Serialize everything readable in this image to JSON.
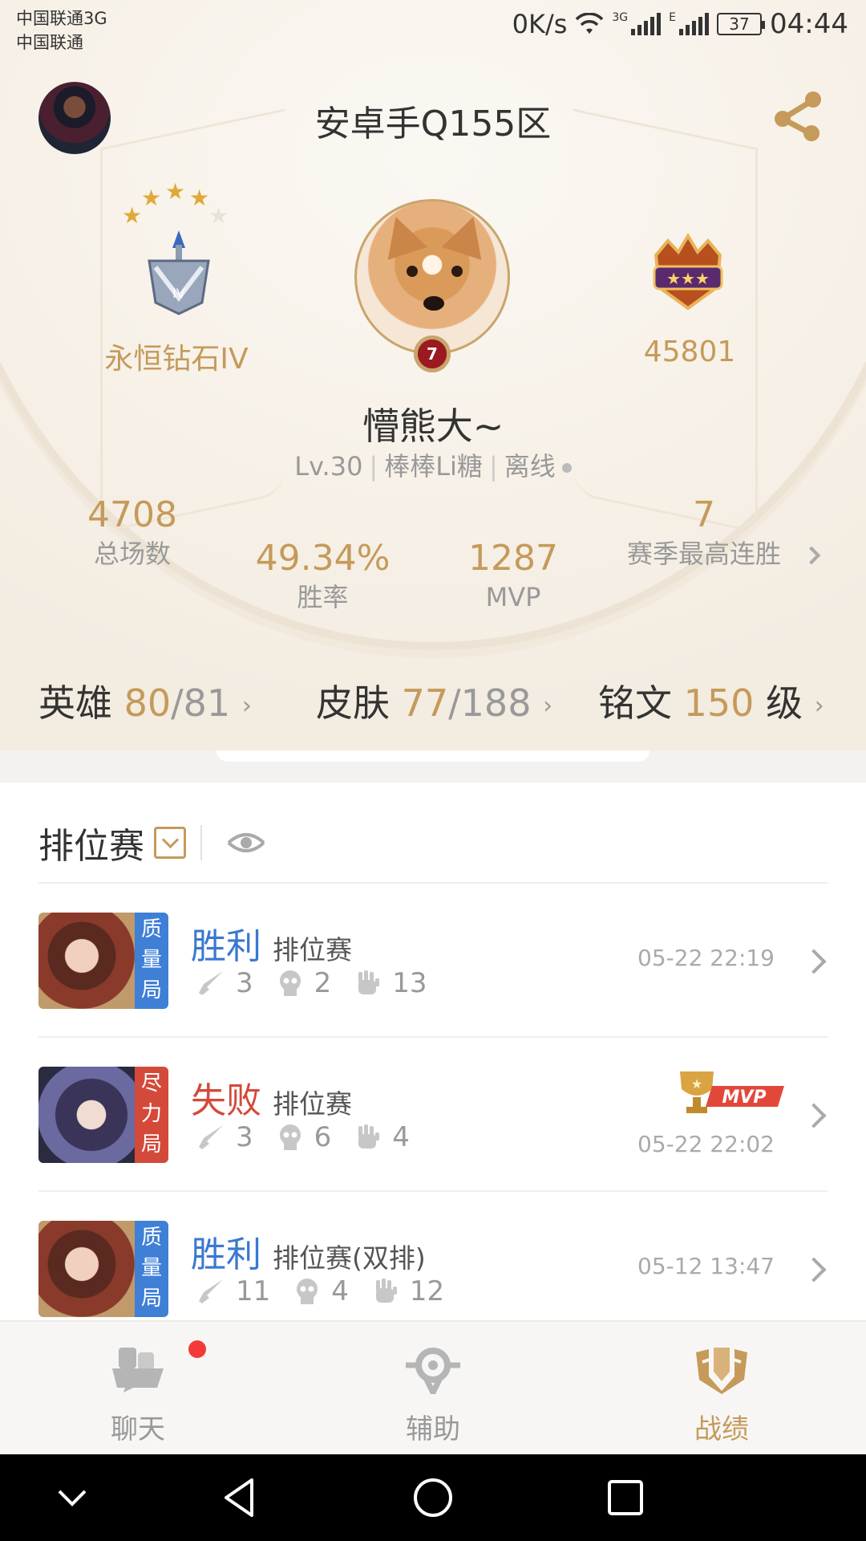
{
  "statusbar": {
    "carrier_line1": "中国联通3G",
    "carrier_line2": "中国联通",
    "net_speed": "0K/s",
    "net_type": "3G",
    "net_type2": "E",
    "battery": "37",
    "time": "04:44"
  },
  "header": {
    "server": "安卓手Q155区",
    "share_icon": "share-icon"
  },
  "profile": {
    "rank_name": "永恒钻石IV",
    "rank_stars": 4,
    "rank_stars_total": 5,
    "level_badge": "7",
    "power_value": "45801",
    "nickname": "懵熊大~",
    "level": "Lv.30",
    "guild": "棒棒Li糖",
    "status": "离线"
  },
  "stats": {
    "total_games": {
      "value": "4708",
      "label": "总场数"
    },
    "win_rate": {
      "value": "49.34%",
      "label": "胜率"
    },
    "mvp": {
      "value": "1287",
      "label": "MVP"
    },
    "streak": {
      "value": "7",
      "label": "赛季最高连胜"
    }
  },
  "counts": {
    "heroes_label": "英雄",
    "heroes_owned": "80",
    "heroes_total": "/81",
    "skins_label": "皮肤",
    "skins_owned": "77",
    "skins_total": "/188",
    "rune_label": "铭文",
    "rune_level": "150",
    "rune_unit": "级"
  },
  "list": {
    "title": "排位赛",
    "matches": [
      {
        "tag": [
          "质",
          "量",
          "局"
        ],
        "result": "胜利",
        "mode": "排位赛",
        "kills": "3",
        "deaths": "2",
        "assists": "13",
        "time": "05-22 22:19",
        "mvp": false
      },
      {
        "tag": [
          "尽",
          "力",
          "局"
        ],
        "result": "失败",
        "mode": "排位赛",
        "kills": "3",
        "deaths": "6",
        "assists": "4",
        "time": "05-22 22:02",
        "mvp": true,
        "mvp_label": "MVP"
      },
      {
        "tag": [
          "质",
          "量",
          "局"
        ],
        "result": "胜利",
        "mode": "排位赛(双排)",
        "kills": "11",
        "deaths": "4",
        "assists": "12",
        "time": "05-12 13:47",
        "mvp": false
      }
    ]
  },
  "bottom_nav": {
    "chat": "聊天",
    "assist": "辅助",
    "record": "战绩",
    "active": "record"
  },
  "colors": {
    "gold": "#c59a5a",
    "win_blue": "#3a78d0",
    "loss_red": "#d24a3a"
  }
}
